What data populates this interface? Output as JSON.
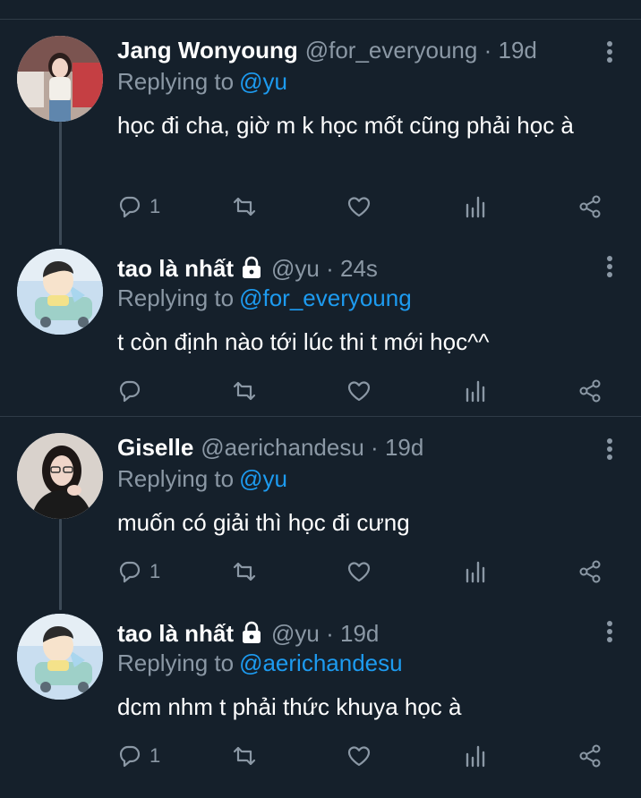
{
  "tweets": [
    {
      "name": "Jang Wonyoung",
      "handle": "@for_everyoung",
      "time": "19d",
      "locked": false,
      "replying_label": "Replying to",
      "replying_to": "@yu",
      "text": "học đi cha, giờ m k học mốt cũng phải học à",
      "reply_count": "1",
      "retweet_count": "",
      "like_count": ""
    },
    {
      "name": "tao là nhất",
      "handle": "@yu",
      "time": "24s",
      "locked": true,
      "replying_label": "Replying to",
      "replying_to": "@for_everyoung",
      "text": "t còn định nào tới lúc thi t mới học^^",
      "reply_count": "",
      "retweet_count": "",
      "like_count": ""
    },
    {
      "name": "Giselle",
      "handle": "@aerichandesu",
      "time": "19d",
      "locked": false,
      "replying_label": "Replying to",
      "replying_to": "@yu",
      "text": "muốn có giải thì học đi cưng",
      "reply_count": "1",
      "retweet_count": "",
      "like_count": ""
    },
    {
      "name": "tao là nhất",
      "handle": "@yu",
      "time": "19d",
      "locked": true,
      "replying_label": "Replying to",
      "replying_to": "@aerichandesu",
      "text": "dcm nhm t phải thức khuya học à",
      "reply_count": "1",
      "retweet_count": "",
      "like_count": ""
    }
  ],
  "separator": "·",
  "colors": {
    "background": "#15202b",
    "secondary_text": "#8b98a5",
    "link": "#1d9bf0",
    "divider": "#2f3b47"
  },
  "icons": [
    "reply-icon",
    "retweet-icon",
    "like-icon",
    "stats-icon",
    "share-icon",
    "lock-icon",
    "more-icon"
  ]
}
